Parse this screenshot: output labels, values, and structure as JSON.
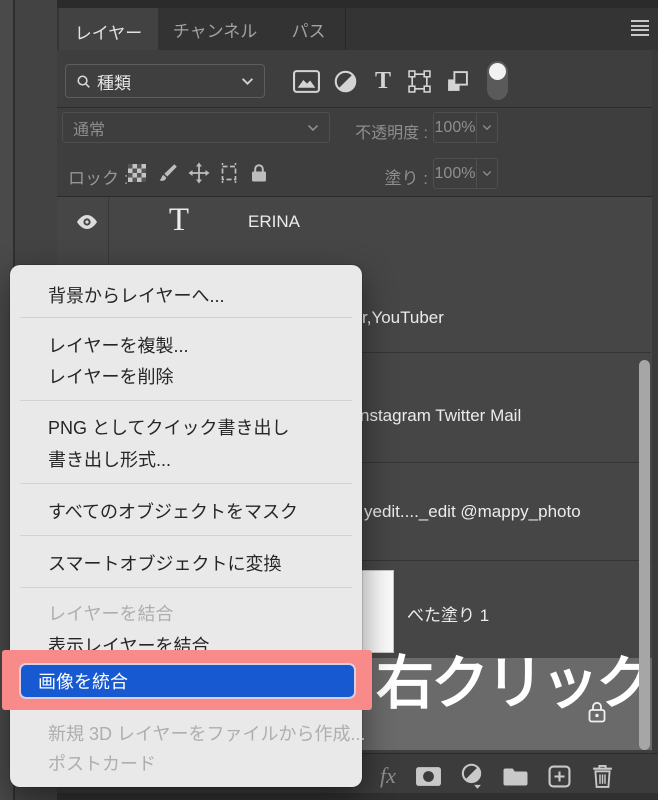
{
  "tabs": [
    {
      "label": "レイヤー",
      "active": true
    },
    {
      "label": "チャンネル",
      "active": false
    },
    {
      "label": "パス",
      "active": false
    }
  ],
  "panel_menu_icon": "hamburger-menu-icon",
  "filter": {
    "search_label": "種類",
    "search_icon": "search-icon",
    "type_filter_glyph": "T",
    "icons": [
      "pixel-layer-filter-icon",
      "adjustment-layer-filter-icon",
      "type-layer-filter-icon",
      "shape-layer-filter-icon",
      "smart-object-filter-icon",
      "filter-toggle"
    ]
  },
  "blend": {
    "mode": "通常",
    "opacity_label": "不透明度 :",
    "opacity_value": "100%"
  },
  "lock": {
    "label": "ロック :",
    "icons": [
      "lock-transparency-icon",
      "lock-paint-icon",
      "lock-move-icon",
      "lock-artboard-icon",
      "lock-all-icon"
    ],
    "fill_label": "塗り :",
    "fill_value": "100%"
  },
  "layers": {
    "visibility_icon": "eye-icon",
    "rows": [
      {
        "label": "ERINA",
        "thumb_glyph": "T"
      },
      {
        "label": "r,YouTuber"
      },
      {
        "label": "nstagram Twitter Mail"
      },
      {
        "label": "yedit...._edit @mappy_photo"
      },
      {
        "label": "べた塗り 1"
      }
    ],
    "background_row": {
      "locked": true,
      "lock_icon": "lock-icon"
    }
  },
  "context_menu": {
    "items": [
      {
        "label": "背景からレイヤーへ..."
      },
      {
        "label": "レイヤーを複製..."
      },
      {
        "label": "レイヤーを削除"
      },
      {
        "label": "PNG としてクイック書き出し"
      },
      {
        "label": "書き出し形式..."
      },
      {
        "label": "すべてのオブジェクトをマスク"
      },
      {
        "label": "スマートオブジェクトに変換"
      },
      {
        "label": "レイヤーを結合",
        "disabled": true
      },
      {
        "label": "表示レイヤーを結合"
      },
      {
        "label": "画像を統合",
        "selected": true
      },
      {
        "label": "新規 3D レイヤーをファイルから作成...",
        "disabled": true
      },
      {
        "label": "ポストカード",
        "disabled": true
      }
    ]
  },
  "annotation": {
    "big_text": "右クリック",
    "highlight_color": "#f98a8a",
    "selection_color": "#1659d0"
  },
  "bottom_bar": {
    "fx_label": "fx",
    "icons": [
      "layer-style-fx",
      "add-layer-mask-icon",
      "adjustment-layer-icon",
      "new-group-icon",
      "new-layer-icon",
      "delete-layer-icon"
    ]
  },
  "colors": {
    "panel_bg": "#404040",
    "row_bg": "#464646",
    "selected_row_bg": "#6a6a6a",
    "menu_bg": "#e9e9e9",
    "menu_text": "#262626",
    "menu_disabled_text": "#aeaeae"
  }
}
